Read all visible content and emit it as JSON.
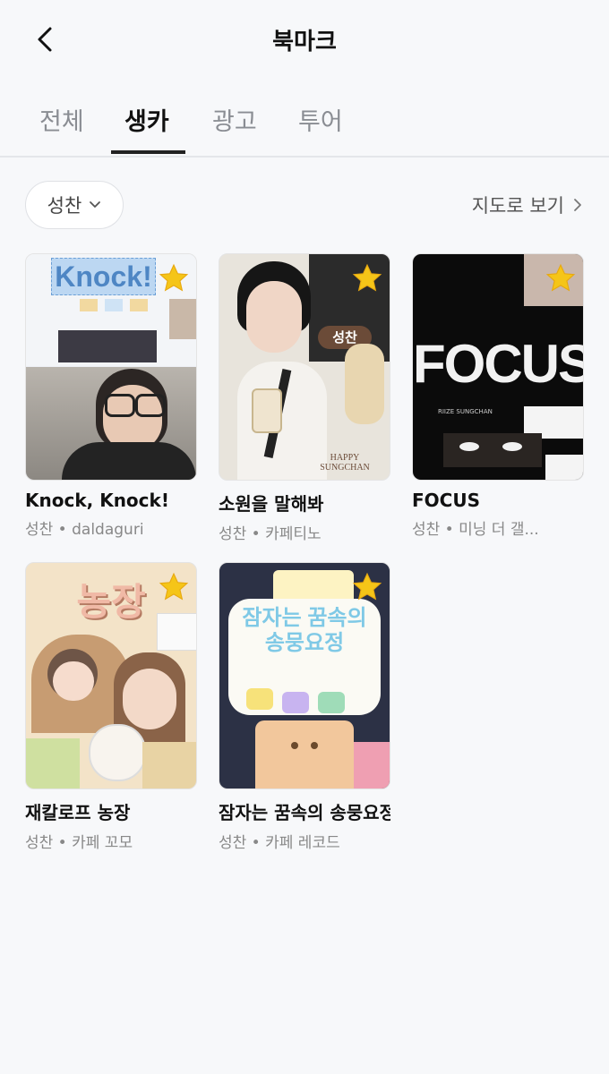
{
  "header": {
    "title": "북마크",
    "back_icon": "chevron-left-icon"
  },
  "tabs": [
    {
      "label": "전체",
      "active": false
    },
    {
      "label": "생카",
      "active": true
    },
    {
      "label": "광고",
      "active": false
    },
    {
      "label": "투어",
      "active": false
    }
  ],
  "filter": {
    "selected": "성찬",
    "icon": "chevron-down-icon"
  },
  "map_link": {
    "label": "지도로 보기",
    "icon": "chevron-right-icon"
  },
  "colors": {
    "accent": "#222222",
    "star": "#f5c518",
    "muted": "#888888"
  },
  "cards": [
    {
      "title": "Knock, Knock!",
      "artist": "성찬",
      "venue": "daldaguri",
      "poster_text": "Knock!",
      "bookmarked": true
    },
    {
      "title": "소원을 말해봐",
      "artist": "성찬",
      "venue": "카페티노",
      "poster_text": "성찬",
      "poster_caption": "HAPPY SUNGCHAN",
      "bookmarked": true
    },
    {
      "title": "FOCUS",
      "artist": "성찬",
      "venue": "미닝 더 갤...",
      "poster_text": "FOCUS",
      "poster_caption": "RIIZE SUNGCHAN",
      "bookmarked": true
    },
    {
      "title": "재칼로프 농장",
      "artist": "성찬",
      "venue": "카페 꼬모",
      "poster_text": "농장",
      "bookmarked": true
    },
    {
      "title": "잠자는 꿈속의 송뭉요정",
      "artist": "성찬",
      "venue": "카페 레코드",
      "poster_text": "잠자는 꿈속의 송뭉요정",
      "bookmarked": true
    }
  ],
  "separator": " • "
}
